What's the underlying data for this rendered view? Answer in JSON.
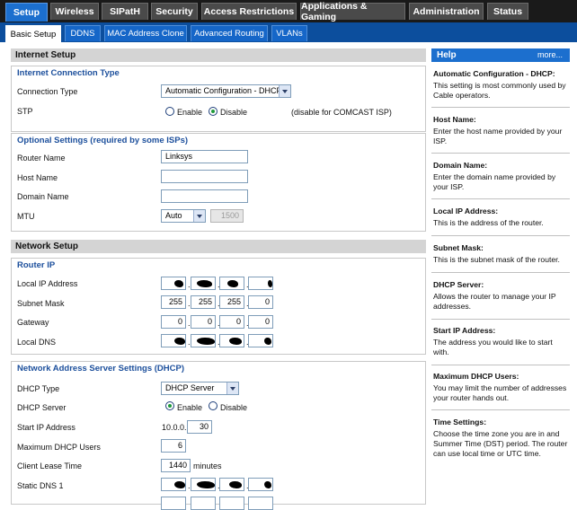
{
  "top_tabs": [
    "Setup",
    "Wireless",
    "SIPatH",
    "Security",
    "Access Restrictions",
    "Applications & Gaming",
    "Administration",
    "Status"
  ],
  "sub_tabs": [
    "Basic Setup",
    "DDNS",
    "MAC Address Clone",
    "Advanced Routing",
    "VLANs"
  ],
  "internet_setup": {
    "header": "Internet Setup",
    "conn_group_title": "Internet Connection Type",
    "connection_type_label": "Connection Type",
    "connection_type_value": "Automatic Configuration - DHCP",
    "stp_label": "STP",
    "stp_enable": "Enable",
    "stp_disable": "Disable",
    "stp_note": "(disable for COMCAST ISP)",
    "optional_title": "Optional Settings (required by some ISPs)",
    "router_name_label": "Router Name",
    "router_name_value": "Linksys",
    "host_name_label": "Host Name",
    "domain_name_label": "Domain Name",
    "mtu_label": "MTU",
    "mtu_mode": "Auto",
    "mtu_value": "1500"
  },
  "network_setup": {
    "header": "Network Setup",
    "router_ip_title": "Router IP",
    "local_ip_label": "Local IP Address",
    "subnet_label": "Subnet Mask",
    "subnet": [
      "255",
      "255",
      "255",
      "0"
    ],
    "gateway_label": "Gateway",
    "gateway": [
      "0",
      "0",
      "0",
      "0"
    ],
    "local_dns_label": "Local DNS",
    "dhcp_title": "Network Address Server Settings (DHCP)",
    "dhcp_type_label": "DHCP Type",
    "dhcp_type_value": "DHCP Server",
    "dhcp_server_label": "DHCP Server",
    "dhcp_enable": "Enable",
    "dhcp_disable": "Disable",
    "start_ip_label": "Start IP Address",
    "start_ip_prefix": "10.0.0.",
    "start_ip_last": "30",
    "max_users_label": "Maximum DHCP Users",
    "max_users_value": "6",
    "lease_label": "Client Lease Time",
    "lease_value": "1440",
    "lease_unit": "minutes",
    "static_dns_label": "Static DNS 1"
  },
  "help": {
    "title": "Help",
    "more": "more...",
    "items": [
      {
        "title": "Automatic Configuration - DHCP:",
        "text": "This setting is most commonly used by Cable operators."
      },
      {
        "title": "Host Name:",
        "text": "Enter the host name provided by your ISP."
      },
      {
        "title": "Domain Name:",
        "text": "Enter the domain name provided by your ISP."
      },
      {
        "title": "Local IP Address:",
        "text": "This is the address of the router."
      },
      {
        "title": "Subnet Mask:",
        "text": "This is the subnet mask of the router."
      },
      {
        "title": "DHCP Server:",
        "text": "Allows the router to manage your IP addresses."
      },
      {
        "title": "Start IP Address:",
        "text": "The address you would like to start with."
      },
      {
        "title": "Maximum DHCP Users:",
        "text": "You may limit the number of addresses your router hands out."
      },
      {
        "title": "Time Settings:",
        "text": "Choose the time zone you are in and Summer Time (DST) period. The router can use local time or UTC time."
      }
    ]
  }
}
